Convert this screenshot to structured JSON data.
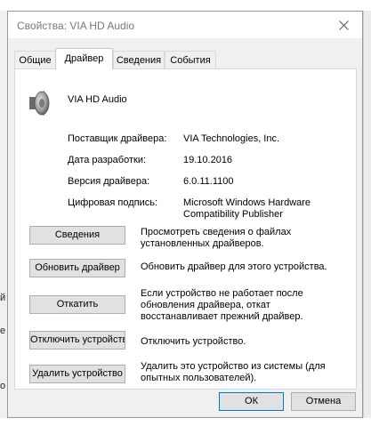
{
  "background": {
    "left_chars": [
      "й",
      "е",
      "о"
    ]
  },
  "window": {
    "title": "Свойства: VIA HD Audio",
    "close_symbol": "✕"
  },
  "tabs": [
    {
      "label": "Общие",
      "active": false
    },
    {
      "label": "Драйвер",
      "active": true
    },
    {
      "label": "Сведения",
      "active": false
    },
    {
      "label": "События",
      "active": false
    }
  ],
  "device": {
    "icon": "speaker-icon",
    "name": "VIA HD Audio"
  },
  "properties": [
    {
      "label": "Поставщик драйвера:",
      "value": "VIA Technologies, Inc."
    },
    {
      "label": "Дата разработки:",
      "value": "19.10.2016"
    },
    {
      "label": "Версия драйвера:",
      "value": "6.0.11.1100"
    },
    {
      "label": "Цифровая подпись:",
      "value_lines": [
        "Microsoft Windows Hardware",
        "Compatibility Publisher"
      ]
    }
  ],
  "actions": [
    {
      "button": "Сведения",
      "desc_lines": [
        "Просмотреть сведения о файлах",
        "установленных драйверов."
      ]
    },
    {
      "button": "Обновить драйвер",
      "desc_lines": [
        "Обновить драйвер для этого устройства."
      ]
    },
    {
      "button": "Откатить",
      "desc_lines": [
        "Если устройство не работает после",
        "обновления драйвера, откат",
        "восстанавливает прежний драйвер."
      ]
    },
    {
      "button": "Отключить устройство",
      "desc_lines": [
        "Отключить устройство."
      ]
    },
    {
      "button": "Удалить устройство",
      "desc_lines": [
        "Удалить это устройство из системы (для",
        "опытных пользователей)."
      ]
    }
  ],
  "footer": {
    "ok": "ОК",
    "cancel": "Отмена"
  }
}
